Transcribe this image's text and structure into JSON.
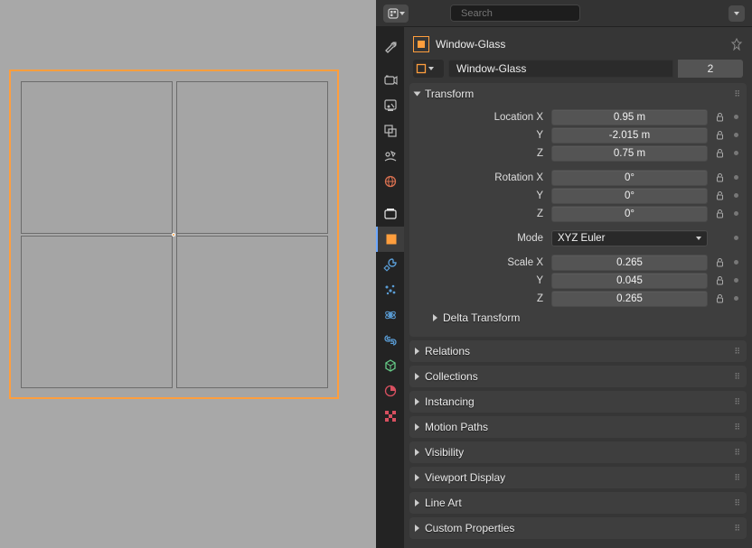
{
  "viewport": {
    "object_selected": true
  },
  "header": {
    "search_placeholder": "Search"
  },
  "breadcrumb": {
    "object_name": "Window-Glass"
  },
  "datablock": {
    "name": "Window-Glass",
    "users": "2"
  },
  "panels": {
    "transform": {
      "title": "Transform",
      "loc_label": "Location X",
      "loc_x": "0.95 m",
      "loc_y": "-2.015 m",
      "loc_z": "0.75 m",
      "rot_label": "Rotation X",
      "rot_x": "0°",
      "rot_y": "0°",
      "rot_z": "0°",
      "mode_label": "Mode",
      "mode_value": "XYZ Euler",
      "scale_label": "Scale X",
      "scale_x": "0.265",
      "scale_y": "0.045",
      "scale_z": "0.265",
      "y_label": "Y",
      "z_label": "Z",
      "delta_title": "Delta Transform"
    },
    "relations": "Relations",
    "collections": "Collections",
    "instancing": "Instancing",
    "motion_paths": "Motion Paths",
    "visibility": "Visibility",
    "viewport_display": "Viewport Display",
    "lineart": "Line Art",
    "custom_props": "Custom Properties"
  },
  "icons": {
    "editor_type": "props",
    "tabs": [
      "tool",
      "render",
      "output",
      "viewlayer",
      "scene",
      "world",
      "gap",
      "collection",
      "object",
      "modifier",
      "particle",
      "physics",
      "constraint",
      "data",
      "material",
      "texture"
    ]
  }
}
